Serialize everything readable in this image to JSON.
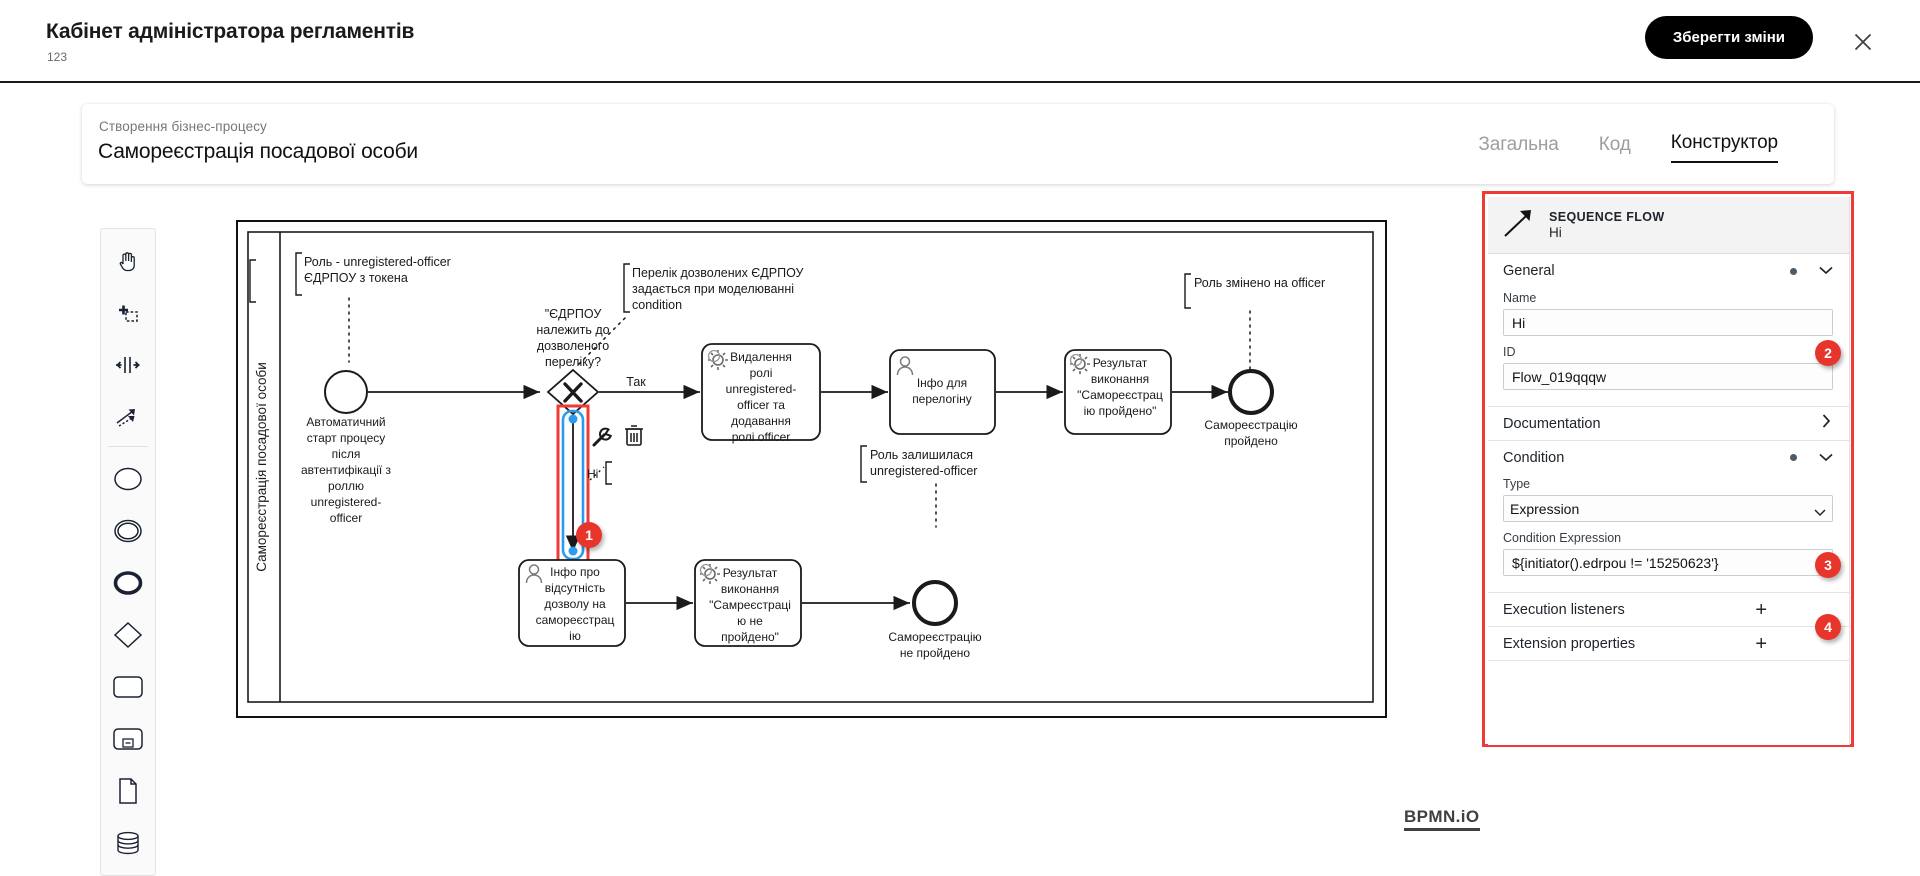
{
  "header": {
    "title": "Кабінет адміністратора регламентів",
    "subtitle": "123",
    "save_label": "Зберегти зміни",
    "close_icon": "close-icon",
    "brand_color": "#000000"
  },
  "subheader": {
    "eyebrow": "Створення бізнес-процесу",
    "name": "Самореєстрація посадової особи",
    "tabs": [
      {
        "label": "Загальна",
        "active": false
      },
      {
        "label": "Код",
        "active": false
      },
      {
        "label": "Конструктор",
        "active": true
      }
    ]
  },
  "palette": {
    "items": [
      {
        "icon": "hand-tool-icon",
        "name": "hand-tool"
      },
      {
        "icon": "lasso-tool-icon",
        "name": "lasso-tool"
      },
      {
        "icon": "space-tool-icon",
        "name": "space-tool"
      },
      {
        "icon": "connect-tool-icon",
        "name": "global-connect-tool"
      },
      {
        "icon": "start-event-icon",
        "name": "create-start-event"
      },
      {
        "icon": "intermediate-event-icon",
        "name": "create-intermediate-event"
      },
      {
        "icon": "end-event-icon",
        "name": "create-end-event"
      },
      {
        "icon": "gateway-icon",
        "name": "create-gateway"
      },
      {
        "icon": "task-icon",
        "name": "create-task"
      },
      {
        "icon": "subprocess-icon",
        "name": "create-subprocess"
      },
      {
        "icon": "data-object-icon",
        "name": "create-data-object"
      },
      {
        "icon": "data-store-icon",
        "name": "create-data-store"
      }
    ]
  },
  "diagram": {
    "pool_label": "Самореєстрація посадової особи",
    "logo": "BPMN.iO",
    "nodes": [
      {
        "id": "start",
        "type": "start-event",
        "label": "Автоматичний старт процесу після автентифікації з роллю unregistered-officer"
      },
      {
        "id": "gateway",
        "type": "exclusive-gateway",
        "label": "\"ЄДРПОУ належить до дозволеного переліку?"
      },
      {
        "id": "task1",
        "type": "service-task",
        "label": "Видалення ролі unregistered-officer та додавання ролі officer"
      },
      {
        "id": "task2",
        "type": "user-task",
        "label": "Інфо для перелогіну"
      },
      {
        "id": "task3",
        "type": "service-task",
        "label": "Результат виконання \"Самореєстрацію пройдено\""
      },
      {
        "id": "end1",
        "type": "end-event",
        "label": "Самореєстрацію пройдено"
      },
      {
        "id": "task4",
        "type": "user-task",
        "label": "Інфо про відсутність дозволу на самореєстрацію"
      },
      {
        "id": "task5",
        "type": "service-task",
        "label": "Результат виконання \"Самреєстрацію не пройдено\""
      },
      {
        "id": "end2",
        "type": "end-event",
        "label": "Самореєстрацію не пройдено"
      }
    ],
    "flow_labels": [
      {
        "id": "yes-flow",
        "label": "Так"
      },
      {
        "id": "selected-flow",
        "label": "Hi"
      }
    ],
    "annotations": [
      {
        "id": "note-role",
        "text": "Роль - unregistered-officer ЄДРПОУ з токена"
      },
      {
        "id": "note-condition",
        "text": "Перелік дозволених ЄДРПОУ задається при моделюванні condition"
      },
      {
        "id": "note-role-changed",
        "text": "Роль змінено на officer"
      },
      {
        "id": "note-role-stays",
        "text": "Роль залишилася unregistered-officer"
      }
    ],
    "context_pad": [
      {
        "icon": "wrench-icon",
        "name": "change-type"
      },
      {
        "icon": "trash-icon",
        "name": "delete-element"
      },
      {
        "icon": "annotation-icon",
        "name": "append-text-annotation"
      }
    ]
  },
  "properties": {
    "header": {
      "icon": "sequence-flow-icon",
      "type": "SEQUENCE FLOW",
      "name": "Hi"
    },
    "groups": [
      {
        "title": "General",
        "state": "expanded"
      },
      {
        "title": "Documentation",
        "state": "collapsed"
      },
      {
        "title": "Condition",
        "state": "expanded"
      },
      {
        "title": "Execution listeners",
        "state": "add"
      },
      {
        "title": "Extension properties",
        "state": "add"
      }
    ],
    "fields": {
      "name_label": "Name",
      "name_value": "Hi",
      "id_label": "ID",
      "id_value": "Flow_019qqqw",
      "type_label": "Type",
      "type_value": "Expression",
      "type_options": [
        "Expression"
      ],
      "condition_label": "Condition Expression",
      "condition_value": "${initiator().edrpou != '15250623'}"
    },
    "plus_label": "+"
  },
  "callouts": [
    {
      "number": "1",
      "target": "selected-sequence-flow"
    },
    {
      "number": "2",
      "target": "name-field"
    },
    {
      "number": "3",
      "target": "type-select"
    },
    {
      "number": "4",
      "target": "condition-expression-field"
    }
  ]
}
